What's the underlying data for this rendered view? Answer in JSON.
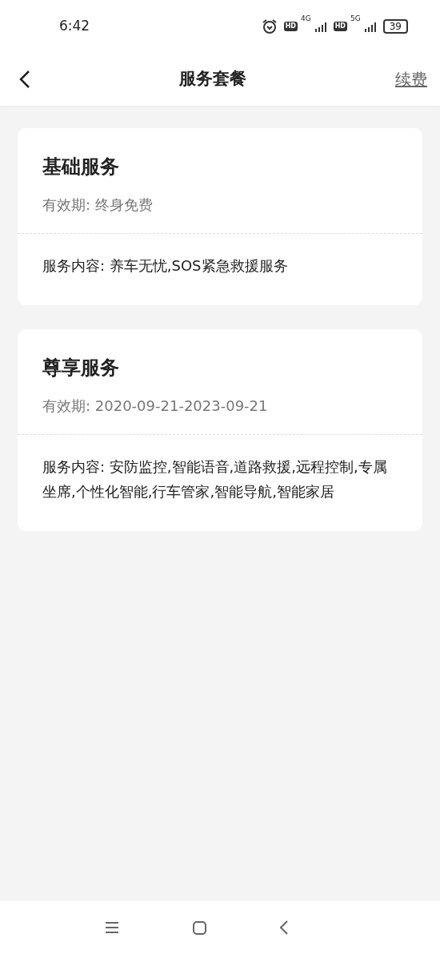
{
  "status_bar": {
    "time": "6:42",
    "hd_badges": [
      "HD",
      "HD"
    ],
    "networks": [
      "4G",
      "5G"
    ],
    "battery": "39"
  },
  "header": {
    "title": "服务套餐",
    "action": "续费"
  },
  "packages": [
    {
      "name": "基础服务",
      "validity": "有效期: 终身免费",
      "content": "服务内容: 养车无忧,SOS紧急救援服务"
    },
    {
      "name": "尊享服务",
      "validity": "有效期: 2020-09-21-2023-09-21",
      "content": "服务内容: 安防监控,智能语音,道路救援,远程控制,专属坐席,个性化智能,行车管家,智能导航,智能家居"
    }
  ]
}
